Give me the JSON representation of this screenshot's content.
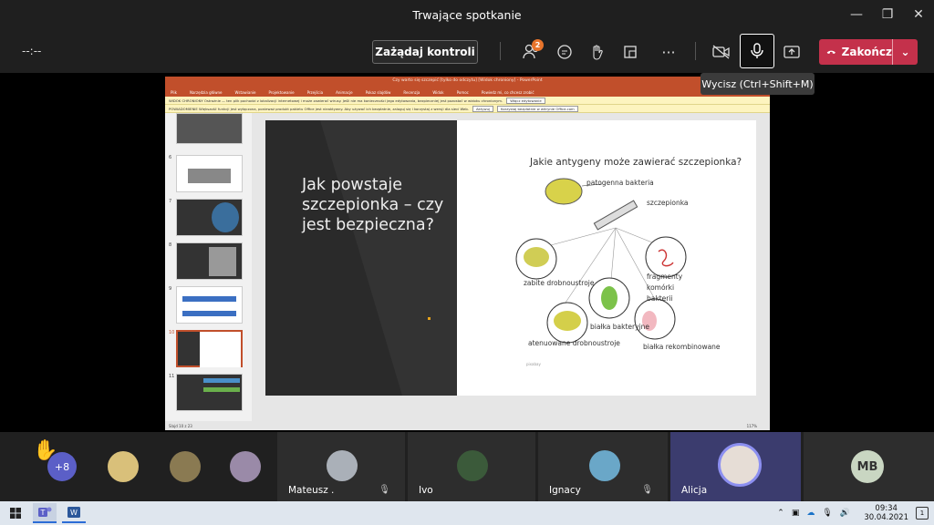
{
  "window": {
    "title": "Trwające spotkanie",
    "controls": [
      "minimize",
      "restore",
      "close"
    ]
  },
  "toolbar": {
    "timer": "--:--",
    "request_control": "Zażądaj kontroli",
    "participants_badge": "2",
    "end_label": "Zakończ",
    "mute_tooltip": "Wycisz (Ctrl+Shift+M)"
  },
  "powerpoint": {
    "title_bar": "Czy warto się szczepić [tylko do odczytu] [Widok chroniony] - PowerPoint",
    "menu": [
      "Plik",
      "Narzędzia główne",
      "Wstawianie",
      "Projektowanie",
      "Przejścia",
      "Animacje",
      "Pokaz slajdów",
      "Recenzja",
      "Widok",
      "Pomoc",
      "Powiedz mi, co chcesz zrobić"
    ],
    "protected_view": "WIDOK CHRONIONY  Ostrożnie — ten plik pochodzi z lokalizacji internetowej i może zawierać wirusy. Jeśli nie ma konieczności jego edytowania, bezpieczniej jest pozostać w widoku chronionym.",
    "protected_btn": "Włącz edytowanie",
    "notice": "POWIADOMIENIE  Większość funkcji jest wyłączona, ponieważ produkt pakietu Office jest nieaktywny. Aby używać ich bezpłatnie, zaloguj się i korzystaj z wersji dla sieci Web.",
    "notice_btn1": "Aktywuj",
    "notice_btn2": "Korzystaj bezpłatnie w witrynie Office.com",
    "thumb_numbers": [
      "6",
      "7",
      "8",
      "9",
      "10",
      "11"
    ],
    "status": "Slajd 10 z 23",
    "zoom": "117%",
    "slide": {
      "title": "Jak powstaje szczepionka – czy jest bezpieczna?",
      "vac_title": "Jakie antygeny może zawierać szczepionka?",
      "labels": {
        "pathogen": "patogenna bakteria",
        "vaccine": "szczepionka",
        "killed": "zabite drobnoustroje",
        "fragments": "fragmenty komórki bakterii",
        "bacterial_protein": "białka bakteryjne",
        "attenuated": "atenuowane drobnoustroje",
        "recombinant": "białka rekombinowane",
        "source": "pixabay"
      }
    }
  },
  "participants": {
    "overflow": "+8",
    "tiles": [
      {
        "name": "Mateusz ."
      },
      {
        "name": "Ivo"
      },
      {
        "name": "Ignacy"
      },
      {
        "name": "Alicja"
      },
      {
        "initials": "MB"
      }
    ]
  },
  "taskbar": {
    "time": "09:34",
    "date": "30.04.2021",
    "notif_count": "1"
  }
}
